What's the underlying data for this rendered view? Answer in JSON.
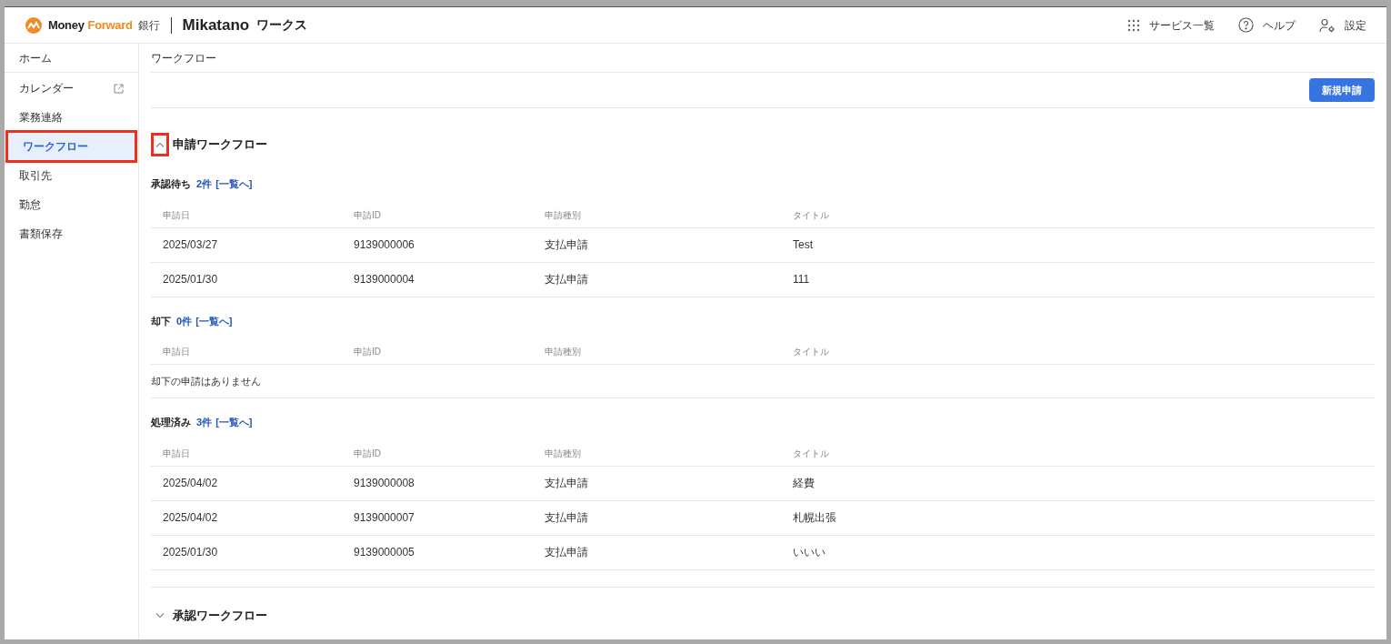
{
  "header": {
    "logo": {
      "money": "Money",
      "forward": "Forward",
      "bank": "銀行",
      "product": "Mikatano",
      "product_suffix": "ワークス"
    },
    "links": [
      {
        "label": "サービス一覧",
        "kind": "grid"
      },
      {
        "label": "ヘルプ",
        "kind": "help"
      },
      {
        "label": "設定",
        "kind": "settings"
      }
    ]
  },
  "sidebar": {
    "items": [
      {
        "label": "ホーム",
        "selected": false,
        "highlighted": false,
        "external": false
      },
      {
        "label": "カレンダー",
        "selected": false,
        "highlighted": false,
        "external": true
      },
      {
        "label": "業務連絡",
        "selected": false,
        "highlighted": false,
        "external": false
      },
      {
        "label": "ワークフロー",
        "selected": true,
        "highlighted": true,
        "external": false
      },
      {
        "label": "取引先",
        "selected": false,
        "highlighted": false,
        "external": false
      },
      {
        "label": "勤怠",
        "selected": false,
        "highlighted": false,
        "external": false
      },
      {
        "label": "書類保存",
        "selected": false,
        "highlighted": false,
        "external": false
      }
    ]
  },
  "page_title": "ワークフロー",
  "new_button": "新規申請",
  "sections": [
    {
      "title": "申請ワークフロー",
      "expanded": true,
      "highlighted": true,
      "groups": [
        {
          "label": "承認待ち",
          "count": "2件",
          "link": "[一覧へ]",
          "columns": [
            "申請日",
            "申請ID",
            "申請種別",
            "タイトル"
          ],
          "rows": [
            [
              "2025/03/27",
              "9139000006",
              "支払申請",
              "Test"
            ],
            [
              "2025/01/30",
              "9139000004",
              "支払申請",
              "111"
            ]
          ]
        },
        {
          "label": "却下",
          "count": "0件",
          "link": "[一覧へ]",
          "columns": [
            "申請日",
            "申請ID",
            "申請種別",
            "タイトル"
          ],
          "empty_message": "却下の申請はありません"
        },
        {
          "label": "処理済み",
          "count": "3件",
          "link": "[一覧へ]",
          "columns": [
            "申請日",
            "申請ID",
            "申請種別",
            "タイトル"
          ],
          "rows": [
            [
              "2025/04/02",
              "9139000008",
              "支払申請",
              "経費"
            ],
            [
              "2025/04/02",
              "9139000007",
              "支払申請",
              "札幌出張"
            ],
            [
              "2025/01/30",
              "9139000005",
              "支払申請",
              "いいい"
            ]
          ]
        }
      ]
    },
    {
      "title": "承認ワークフロー",
      "expanded": false,
      "highlighted": false
    }
  ]
}
